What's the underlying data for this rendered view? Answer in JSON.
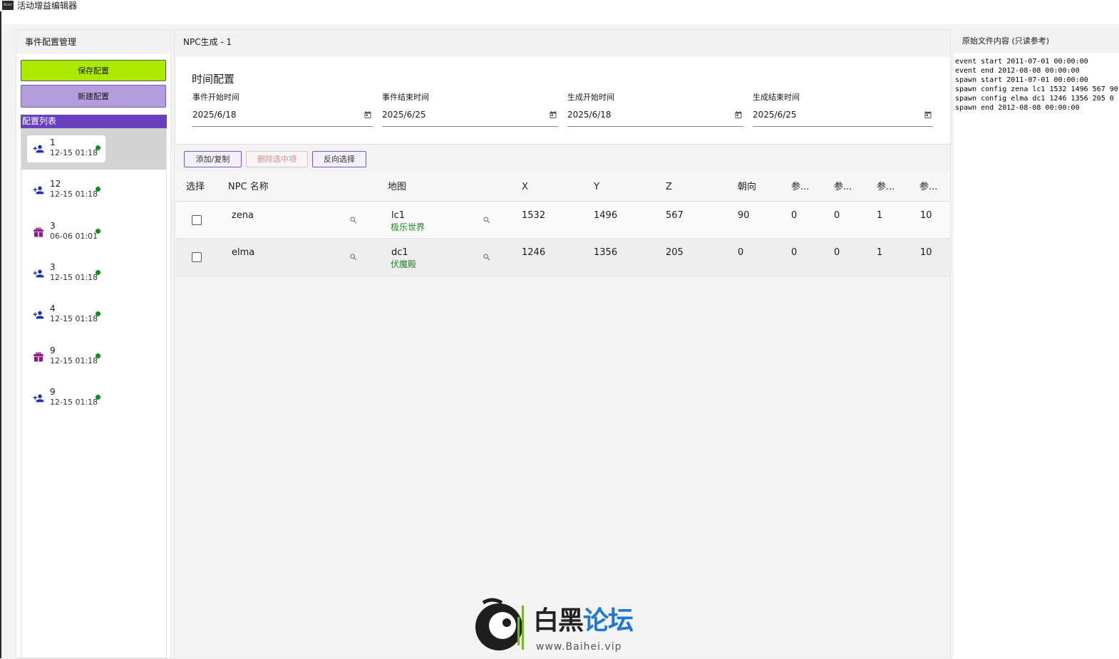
{
  "window": {
    "title": "活动增益编辑器",
    "icon_text": "Acon"
  },
  "left_panel": {
    "header": "事件配置管理",
    "save_label": "保存配置",
    "new_label": "新建配置",
    "list_title": "配置列表",
    "items": [
      {
        "name": "1",
        "time": "12-15 01:18",
        "icon": "person-add-icon",
        "status": "active",
        "selected": true
      },
      {
        "name": "12",
        "time": "12-15 01:18",
        "icon": "person-add-icon",
        "status": "active",
        "selected": false
      },
      {
        "name": "3",
        "time": "06-06 01:01",
        "icon": "gift-icon",
        "status": "active",
        "selected": false
      },
      {
        "name": "3",
        "time": "12-15 01:18",
        "icon": "person-add-icon",
        "status": "active",
        "selected": false
      },
      {
        "name": "4",
        "time": "12-15 01:18",
        "icon": "person-add-icon",
        "status": "active",
        "selected": false
      },
      {
        "name": "9",
        "time": "12-15 01:18",
        "icon": "gift-icon",
        "status": "active",
        "selected": false
      },
      {
        "name": "9",
        "time": "12-15 01:18",
        "icon": "person-add-icon",
        "status": "active",
        "selected": false
      }
    ]
  },
  "center_panel": {
    "header": "NPC生成 - 1",
    "time_config": {
      "title": "时间配置",
      "fields": [
        {
          "label": "事件开始时间",
          "value": "2025/6/18"
        },
        {
          "label": "事件结束时间",
          "value": "2025/6/25"
        },
        {
          "label": "生成开始时间",
          "value": "2025/6/18"
        },
        {
          "label": "生成结束时间",
          "value": "2025/6/25"
        }
      ]
    },
    "toolbar": {
      "add_copy": "添加/复制",
      "delete_selected": "删除选中项",
      "invert_selection": "反向选择"
    },
    "table": {
      "columns": [
        "选择",
        "NPC 名称",
        "地图",
        "X",
        "Y",
        "Z",
        "朝向",
        "参...",
        "参...",
        "参...",
        "参..."
      ],
      "rows": [
        {
          "npc": "zena",
          "map": "lc1",
          "map_name": "极乐世界",
          "x": "1532",
          "y": "1496",
          "z": "567",
          "dir": "90",
          "p1": "0",
          "p2": "0",
          "p3": "1",
          "p4": "10"
        },
        {
          "npc": "elma",
          "map": "dc1",
          "map_name": "伏魔殿",
          "x": "1246",
          "y": "1356",
          "z": "205",
          "dir": "0",
          "p1": "0",
          "p2": "0",
          "p3": "1",
          "p4": "10"
        }
      ]
    }
  },
  "right_panel": {
    "header": "原始文件内容 (只读参考)",
    "raw_text": "event start 2011-07-01 00:00:00\nevent end 2012-08-08 00:00:00\nspawn start 2011-07-01 00:00:00\nspawn config zena lc1 1532 1496 567 90\nspawn config elma dc1 1246 1356 205 0\nspawn end 2012-08-08 00:00:00"
  },
  "watermark": {
    "title": "白黑论坛",
    "url": "www.Baihei.vip"
  },
  "colors": {
    "save_button": "#aaea00",
    "new_button": "#b39ddb",
    "list_header": "#6a3fbf",
    "status_dot": "#178a1a",
    "map_name": "#1a8a1a",
    "icon_person": "#1e2fb3",
    "icon_gift": "#8e1c87"
  }
}
